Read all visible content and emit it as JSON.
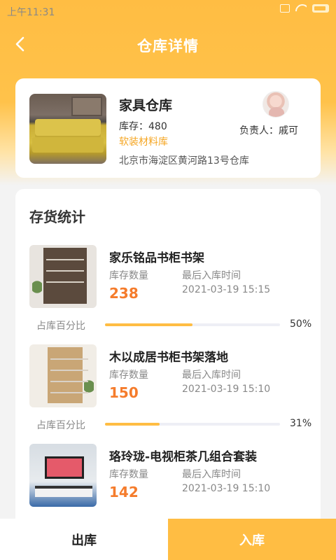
{
  "status_bar": {
    "time": "上午11:31"
  },
  "nav": {
    "title": "仓库详情"
  },
  "warehouse": {
    "name": "家具仓库",
    "stock": "库存：480",
    "category": "软装材料库",
    "address": "北京市海淀区黄河路13号仓库",
    "manager": "负责人：戚可"
  },
  "stats": {
    "title": "存货统计",
    "qty_label": "库存数量",
    "time_label": "最后入库时间",
    "pct_label": "占库百分比",
    "items": [
      {
        "name": "家乐铭品书柜书架",
        "qty": "238",
        "time": "2021-03-19 15:15",
        "percent_text": "50%",
        "percent": 0.5
      },
      {
        "name": "木以成居书柜书架落地",
        "qty": "150",
        "time": "2021-03-19 15:10",
        "percent_text": "31%",
        "percent": 0.31
      },
      {
        "name": "珞玲珑-电视柜茶几组合套装",
        "qty": "142",
        "time": "2021-03-19 15:10"
      }
    ]
  },
  "actions": {
    "out": "出库",
    "in": "入库"
  },
  "colors": {
    "accent": "#ffbd43",
    "quantity": "#f57c2c",
    "category": "#f5a623"
  }
}
